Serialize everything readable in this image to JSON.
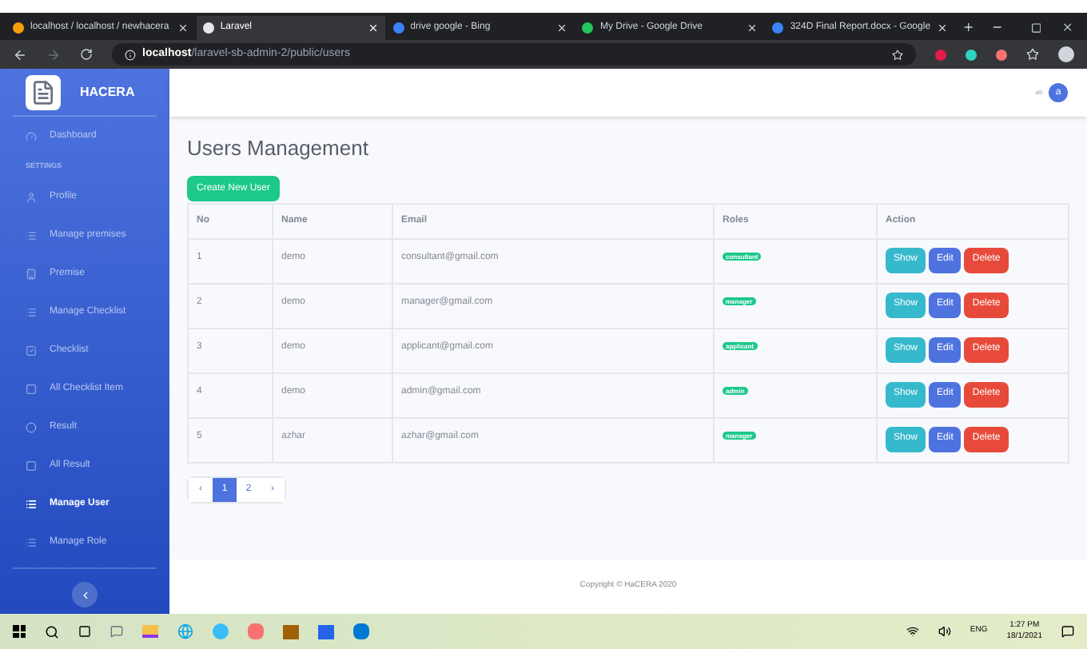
{
  "browser": {
    "tabs": [
      {
        "label": "localhost / localhost / newhacera",
        "selected": false
      },
      {
        "label": "Laravel",
        "selected": true
      },
      {
        "label": "drive google - Bing",
        "selected": false
      },
      {
        "label": "My Drive - Google Drive",
        "selected": false
      },
      {
        "label": "324D Final Report.docx - Google",
        "selected": false
      }
    ],
    "url_host": "localhost",
    "url_path": "/laravel-sb-admin-2/public/users"
  },
  "sidebar": {
    "brand": "HACERA",
    "items": [
      {
        "kind": "link",
        "label": "Dashboard",
        "selected": false
      },
      {
        "kind": "heading",
        "label": "SETTINGS"
      },
      {
        "kind": "link",
        "label": "Profile",
        "selected": false
      },
      {
        "kind": "link",
        "label": "Manage premises",
        "selected": false
      },
      {
        "kind": "link",
        "label": "Premise",
        "selected": false
      },
      {
        "kind": "link",
        "label": "Manage Checklist",
        "selected": false
      },
      {
        "kind": "link",
        "label": "Checklist",
        "selected": false
      },
      {
        "kind": "link",
        "label": "All Checklist Item",
        "selected": false
      },
      {
        "kind": "link",
        "label": "Result",
        "selected": false
      },
      {
        "kind": "link",
        "label": "All Result",
        "selected": false
      },
      {
        "kind": "link",
        "label": "Manage User",
        "selected": true
      },
      {
        "kind": "link",
        "label": "Manage Role",
        "selected": false
      }
    ]
  },
  "topbar": {
    "user_name": "ati",
    "avatar": "a"
  },
  "page": {
    "title": "Users Management",
    "create_button": "Create New User"
  },
  "table": {
    "columns": [
      "No",
      "Name",
      "Email",
      "Roles",
      "Action"
    ],
    "rows": [
      {
        "no": "1",
        "name": "demo",
        "email": "consultant@gmail.com",
        "role": "consultant",
        "actions": [
          {
            "kind": "show",
            "label": "Show"
          },
          {
            "kind": "edit",
            "label": "Edit"
          },
          {
            "kind": "delete",
            "label": "Delete"
          }
        ]
      },
      {
        "no": "2",
        "name": "demo",
        "email": "manager@gmail.com",
        "role": "manager",
        "actions": [
          {
            "kind": "show",
            "label": "Show"
          },
          {
            "kind": "edit",
            "label": "Edit"
          },
          {
            "kind": "delete",
            "label": "Delete"
          }
        ]
      },
      {
        "no": "3",
        "name": "demo",
        "email": "applicant@gmail.com",
        "role": "applicant",
        "actions": [
          {
            "kind": "show",
            "label": "Show"
          },
          {
            "kind": "edit",
            "label": "Edit"
          },
          {
            "kind": "delete",
            "label": "Delete"
          }
        ]
      },
      {
        "no": "4",
        "name": "demo",
        "email": "admin@gmail.com",
        "role": "admin",
        "actions": [
          {
            "kind": "show",
            "label": "Show"
          },
          {
            "kind": "edit",
            "label": "Edit"
          },
          {
            "kind": "delete",
            "label": "Delete"
          }
        ]
      },
      {
        "no": "5",
        "name": "azhar",
        "email": "azhar@gmail.com",
        "role": "manager",
        "actions": [
          {
            "kind": "show",
            "label": "Show"
          },
          {
            "kind": "edit",
            "label": "Edit"
          },
          {
            "kind": "delete",
            "label": "Delete"
          }
        ]
      }
    ]
  },
  "pagination": [
    {
      "label": "‹",
      "selected": false,
      "disabled": true
    },
    {
      "label": "1",
      "selected": true,
      "disabled": false
    },
    {
      "label": "2",
      "selected": false,
      "disabled": false
    },
    {
      "label": "›",
      "selected": false,
      "disabled": false
    }
  ],
  "footer": "Copyright © HaCERA 2020",
  "taskbar": {
    "language": "ENG",
    "time": "1:27 PM",
    "date": "18/1/2021"
  }
}
